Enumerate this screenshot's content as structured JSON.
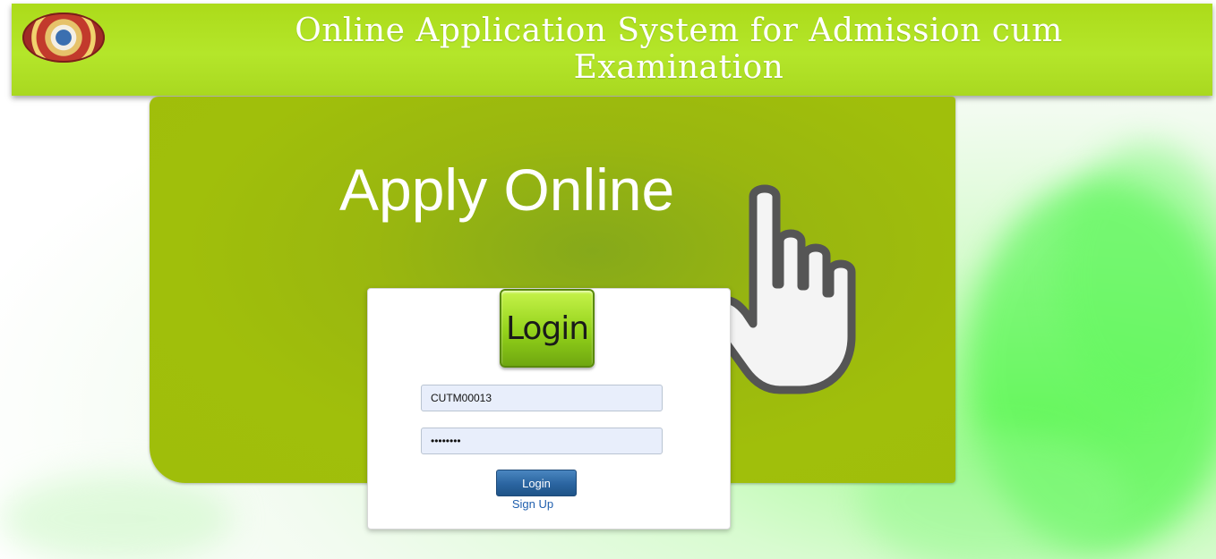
{
  "header": {
    "title": "Online Application System for Admission cum Examination"
  },
  "banner": {
    "heading": "Apply Online"
  },
  "login": {
    "badge_text": "Login",
    "username_value": "CUTM00013",
    "password_value": "password",
    "button_label": "Login",
    "signup_label": "Sign Up"
  },
  "colors": {
    "header_bg": "#b4e62a",
    "banner_bg": "#9fbe0a",
    "button_bg": "#2a64a0",
    "link": "#1f5fae"
  },
  "icons": {
    "logo": "university-seal-icon",
    "pointer": "pointing-hand-icon"
  }
}
